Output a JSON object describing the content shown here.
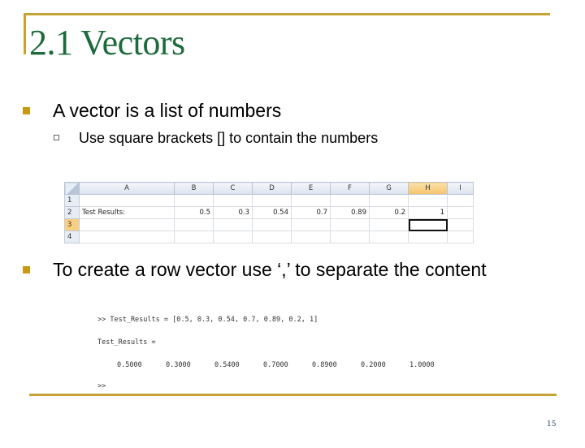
{
  "slide": {
    "title": "2.1 Vectors",
    "page_number": "15",
    "accent_color": "#c4a233",
    "title_color": "#1d6b3c"
  },
  "bullets": [
    {
      "text": "A vector is a list of numbers",
      "sub": [
        {
          "text": "Use square brackets [] to contain the numbers"
        }
      ]
    },
    {
      "text": "To create a row vector use ‘,’ to separate the content"
    }
  ],
  "spreadsheet": {
    "columns": [
      "A",
      "B",
      "C",
      "D",
      "E",
      "F",
      "G",
      "H",
      "I"
    ],
    "selected_column": "H",
    "selected_row": "3",
    "rows": [
      {
        "header": "1",
        "cells": [
          "",
          "",
          "",
          "",
          "",
          "",
          "",
          "",
          ""
        ]
      },
      {
        "header": "2",
        "cells": [
          "Test Results:",
          "0.5",
          "0.3",
          "0.54",
          "0.7",
          "0.89",
          "0.2",
          "1",
          ""
        ]
      },
      {
        "header": "3",
        "cells": [
          "",
          "",
          "",
          "",
          "",
          "",
          "",
          "",
          ""
        ]
      },
      {
        "header": "4",
        "cells": [
          "",
          "",
          "",
          "",
          "",
          "",
          "",
          "",
          ""
        ]
      }
    ]
  },
  "console": {
    "command": ">> Test_Results = [0.5, 0.3, 0.54, 0.7, 0.89, 0.2, 1]",
    "output_label": "Test_Results =",
    "values": [
      "0.5000",
      "0.3000",
      "0.5400",
      "0.7000",
      "0.8900",
      "0.2000",
      "1.0000"
    ],
    "prompt": ">>"
  }
}
